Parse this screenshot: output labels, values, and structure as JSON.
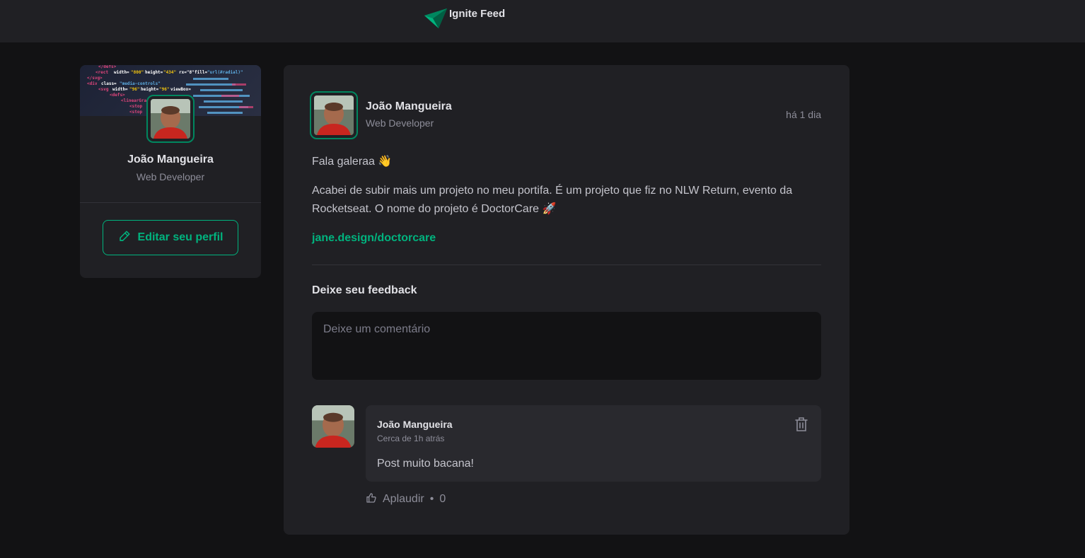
{
  "header": {
    "brand_title": "Ignite Feed",
    "logo_icon": "ignite-logo-icon"
  },
  "colors": {
    "background": "#121214",
    "surface": "#202024",
    "accent": "#00b37e",
    "accent_dark": "#00875f"
  },
  "sidebar": {
    "name": "João Mangueira",
    "role": "Web Developer",
    "edit_button_label": "Editar seu perfil",
    "edit_icon": "pencil-icon"
  },
  "post": {
    "author_name": "João Mangueira",
    "author_role": "Web Developer",
    "time": "há 1 dia",
    "paragraph_1": "Fala galeraa 👋",
    "paragraph_2": "Acabei de subir mais um projeto no meu portifa. É um projeto que fiz no NLW Return, evento da Rocketseat. O nome do projeto é DoctorCare 🚀",
    "link": "jane.design/doctorcare",
    "feedback_title": "Deixe seu feedback",
    "comment_placeholder": "Deixe um comentário"
  },
  "comment": {
    "author": "João Mangueira",
    "time": "Cerca de 1h atrás",
    "text": "Post muito bacana!",
    "delete_icon": "trash-icon",
    "applaud_label": "Aplaudir",
    "applaud_separator": "•",
    "applaud_count": "0",
    "applaud_icon": "thumbs-up-icon"
  }
}
